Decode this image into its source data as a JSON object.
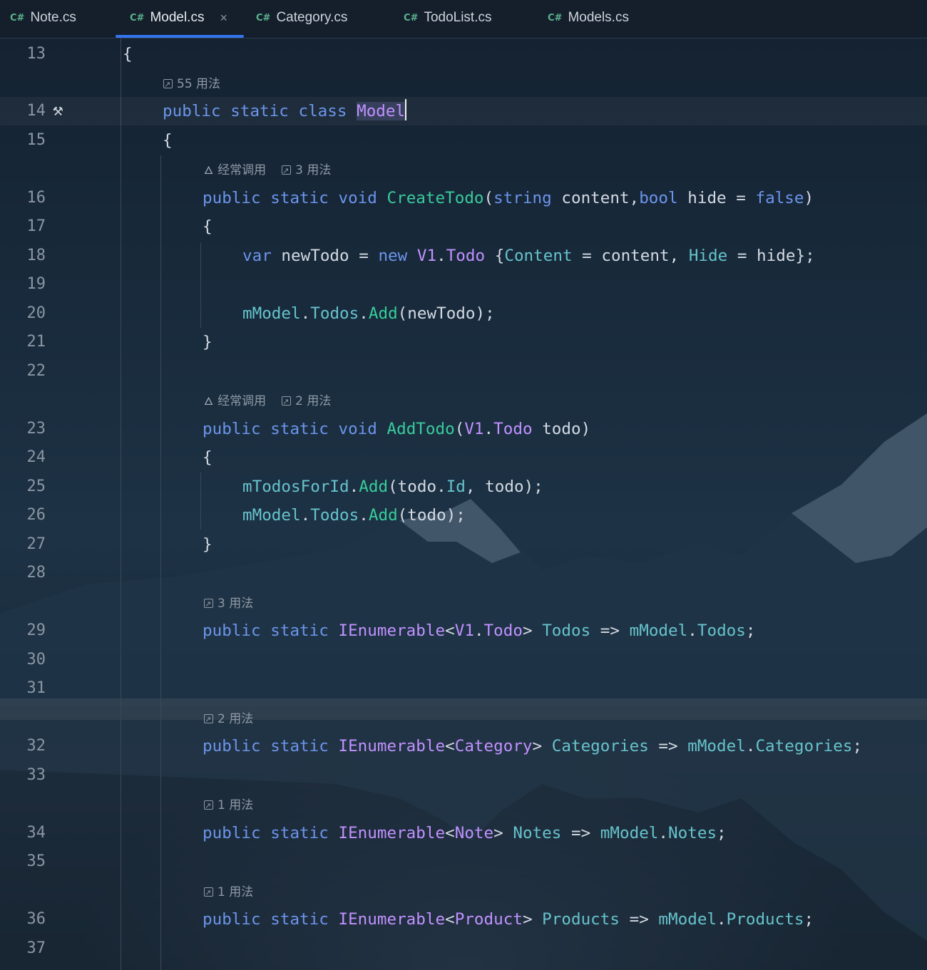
{
  "tabs": [
    {
      "lang": "C#",
      "label": "Note.cs"
    },
    {
      "lang": "C#",
      "label": "Model.cs",
      "active": true,
      "close": "×"
    },
    {
      "lang": "C#",
      "label": "Category.cs"
    },
    {
      "lang": "C#",
      "label": "TodoList.cs"
    },
    {
      "lang": "C#",
      "label": "Models.cs"
    }
  ],
  "hints": {
    "h55": "55 用法",
    "frequent": "经常调用",
    "u3": "3 用法",
    "u2": "2 用法",
    "u1": "1 用法"
  },
  "lines": {
    "n13": "13",
    "n14": "14",
    "n15": "15",
    "n16": "16",
    "n17": "17",
    "n18": "18",
    "n19": "19",
    "n20": "20",
    "n21": "21",
    "n22": "22",
    "n23": "23",
    "n24": "24",
    "n25": "25",
    "n26": "26",
    "n27": "27",
    "n28": "28",
    "n29": "29",
    "n30": "30",
    "n31": "31",
    "n32": "32",
    "n33": "33",
    "n34": "34",
    "n35": "35",
    "n36": "36",
    "n37": "37"
  },
  "code": {
    "open_brace": "{",
    "close_brace": "}",
    "public": "public",
    "static": "static",
    "class": "class",
    "void": "void",
    "model": "Model",
    "createTodo": "CreateTodo",
    "string": "string",
    "content": "content",
    "bool": "bool",
    "hide": "hide",
    "false": "false",
    "var": "var",
    "newTodo": "newTodo",
    "new": "new",
    "v1": "V1",
    "todo_type": "Todo",
    "contentProp": "Content",
    "hideProp": "Hide",
    "mModel": "mModel",
    "todos": "Todos",
    "add": "Add",
    "addTodo": "AddTodo",
    "todo": "todo",
    "mTodosForId": "mTodosForId",
    "id": "Id",
    "ienumerable": "IEnumerable",
    "category": "Category",
    "categories": "Categories",
    "note": "Note",
    "notes": "Notes",
    "product": "Product",
    "products": "Products"
  }
}
